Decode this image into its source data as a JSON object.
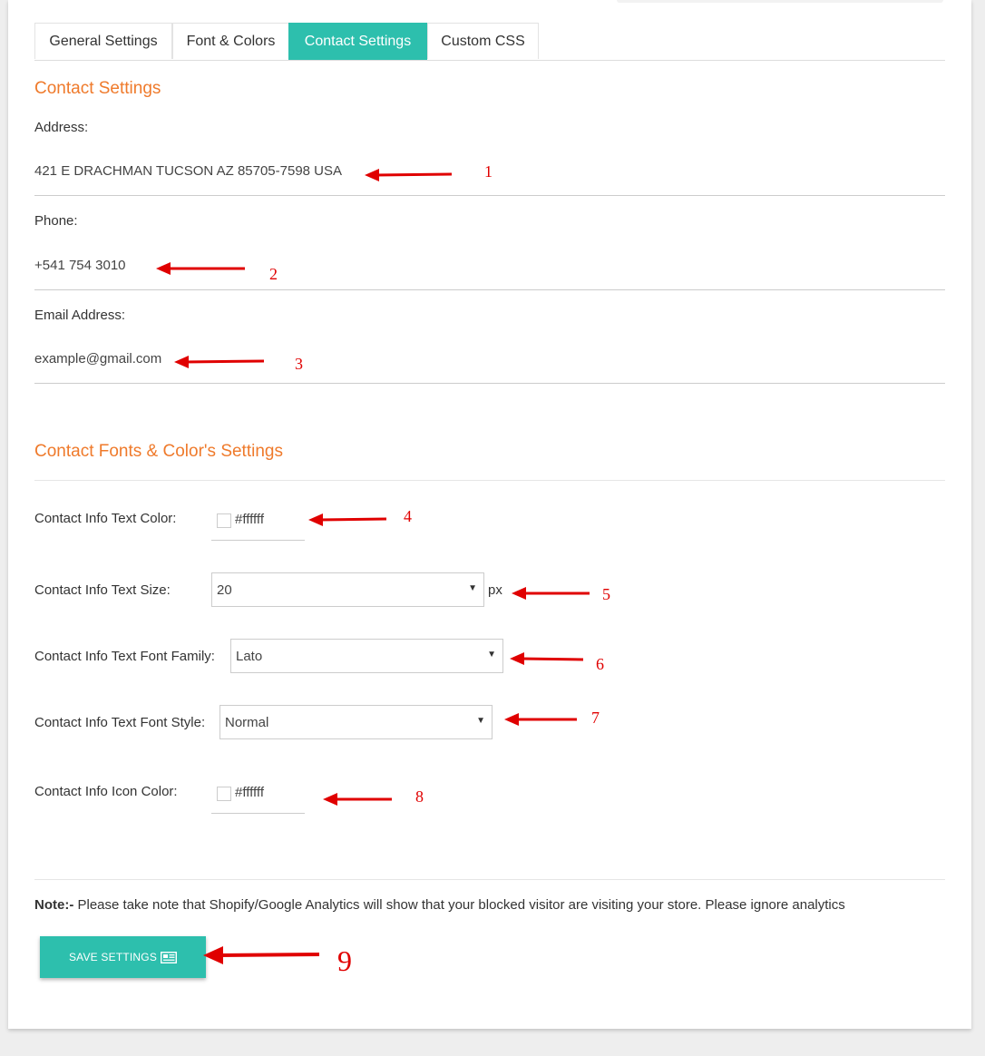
{
  "tabs": [
    {
      "label": "General Settings",
      "active": false
    },
    {
      "label": "Font & Colors",
      "active": false
    },
    {
      "label": "Contact Settings",
      "active": true
    },
    {
      "label": "Custom CSS",
      "active": false
    }
  ],
  "contact": {
    "title": "Contact Settings",
    "address_label": "Address:",
    "address_value": "421 E DRACHMAN TUCSON AZ 85705-7598 USA",
    "phone_label": "Phone:",
    "phone_value": "+541 754 3010",
    "email_label": "Email Address:",
    "email_value": "example@gmail.com"
  },
  "fonts": {
    "title": "Contact Fonts & Color's Settings",
    "text_color_label": "Contact Info Text Color:",
    "text_color_value": "#ffffff",
    "text_size_label": "Contact Info Text Size:",
    "text_size_value": "20",
    "text_size_unit": "px",
    "font_family_label": "Contact Info Text Font Family:",
    "font_family_value": "Lato",
    "font_style_label": "Contact Info Text Font Style:",
    "font_style_value": "Normal",
    "icon_color_label": "Contact Info Icon Color:",
    "icon_color_value": "#ffffff"
  },
  "note": {
    "prefix": "Note:-",
    "text": " Please take note that Shopify/Google Analytics will show that your blocked visitor are visiting your store. Please ignore analytics"
  },
  "save_button": {
    "label": "SAVE SETTINGS",
    "icon": "newspaper-icon"
  },
  "annotations": [
    "1",
    "2",
    "3",
    "4",
    "5",
    "6",
    "7",
    "8",
    "9"
  ],
  "colors": {
    "accent": "#2dbfad",
    "section_title": "#ef7a2b",
    "annotation": "#e00000"
  }
}
